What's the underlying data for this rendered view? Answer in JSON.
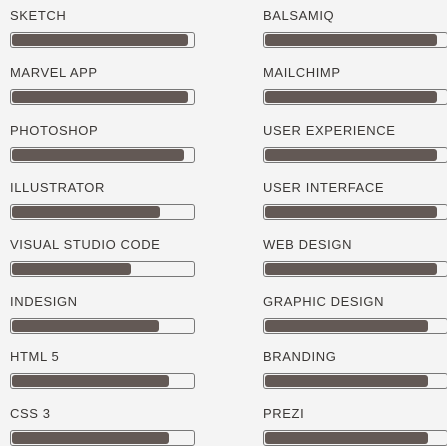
{
  "skills_left": [
    {
      "label": "SKETCH",
      "level": 0.97
    },
    {
      "label": "MARVEL APP",
      "level": 0.97
    },
    {
      "label": "PHOTOSHOP",
      "level": 0.95
    },
    {
      "label": "ILLUSTRATOR",
      "level": 0.82
    },
    {
      "label": "VISUAL STUDIO CODE",
      "level": 0.66
    },
    {
      "label": "INDESIGN",
      "level": 0.81
    },
    {
      "label": "HTML 5",
      "level": 0.87
    },
    {
      "label": "CSS 3",
      "level": 0.87
    }
  ],
  "skills_right": [
    {
      "label": "BALSAMIQ",
      "level": 0.95
    },
    {
      "label": "MAILCHIMP",
      "level": 0.95
    },
    {
      "label": "USER EXPERIENCE",
      "level": 0.95
    },
    {
      "label": "USER INTERFACE",
      "level": 0.95
    },
    {
      "label": "WEB DESIGN",
      "level": 0.95
    },
    {
      "label": "GRAPHIC DESIGN",
      "level": 0.9
    },
    {
      "label": "BRANDING",
      "level": 0.9
    },
    {
      "label": "PREZI",
      "level": 0.9
    }
  ],
  "colors": {
    "fill": "#635955",
    "track_border": "#777777",
    "text": "#3a3735"
  }
}
